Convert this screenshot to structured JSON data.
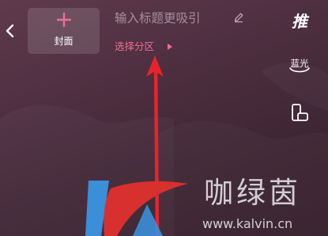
{
  "header": {
    "cover_label": "封面",
    "title_placeholder": "输入标题更吸引",
    "zone_label": "选择分区"
  },
  "sidebar": {
    "push_label": "推",
    "bluray_label": "蓝光"
  },
  "watermark": {
    "brand_cn": "咖绿茵",
    "url": "www.kalvin.cn"
  },
  "colors": {
    "accent_pink": "#f06e93",
    "arrow_red": "#e8232c",
    "logo_blue": "#3b8ed8",
    "logo_red": "#d8302f"
  },
  "icons": {
    "back": "chevron-left-icon",
    "cover_add": "plus-icon",
    "edit": "pencil-icon",
    "zone_caret": "caret-right-icon",
    "push": "push-icon",
    "bluray": "bluray-icon",
    "orientation": "rotate-screen-icon"
  }
}
